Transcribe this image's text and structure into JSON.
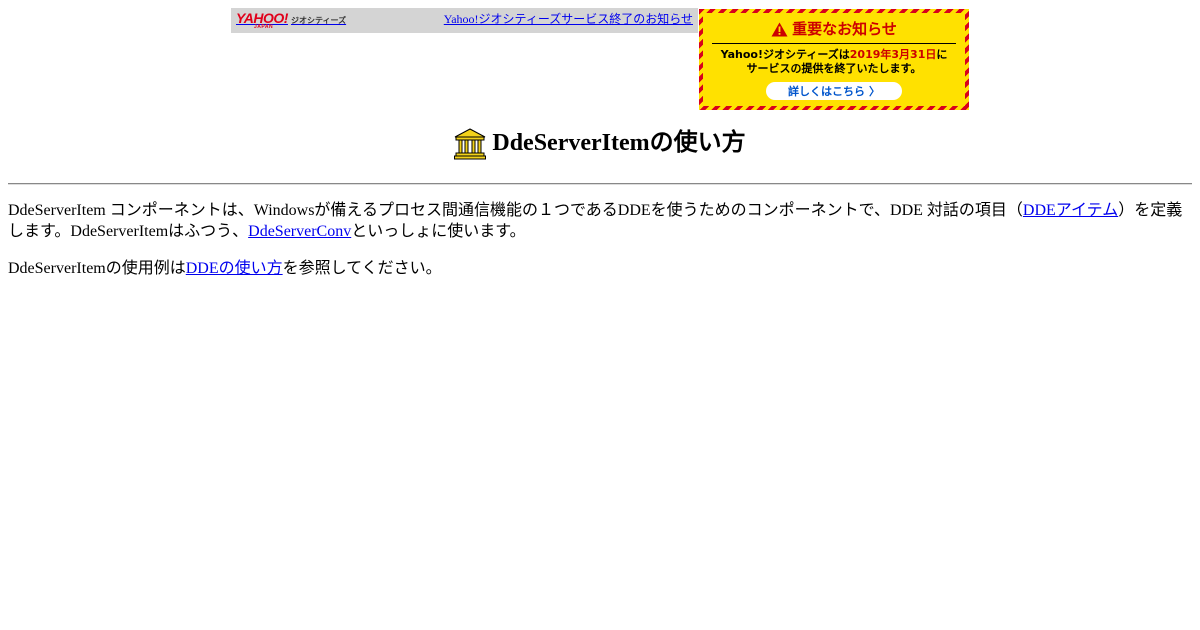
{
  "geo_bar": {
    "logo_text": "YAHOO!",
    "logo_sub": "JAPAN",
    "service_name": "ジオシティーズ",
    "notice_link": "Yahoo!ジオシティーズサービス終了のお知らせ"
  },
  "notice_banner": {
    "title": "重要なお知らせ",
    "line1_prefix": "Yahoo!ジオシティーズは",
    "line1_date": "2019年3月31日",
    "line1_suffix": "に",
    "line2": "サービスの提供を終了いたします。",
    "button_label": "詳しくはこちら",
    "button_chevron": "〉"
  },
  "heading": {
    "title": "DdeServerItemの使い方"
  },
  "body": {
    "p1_part1": "DdeServerItem コンポーネントは、Windowsが備えるプロセス間通信機能の１つであるDDEを使うためのコンポーネントで、DDE 対話の項目（",
    "p1_link1": "DDEアイテム",
    "p1_part2": "）を定義します。DdeServerItemはふつう、",
    "p1_link2": "DdeServerConv",
    "p1_part3": "といっしょに使います。",
    "p2_part1": "DdeServerItemの使用例は",
    "p2_link": "DDEの使い方",
    "p2_part2": "を参照してください。"
  },
  "colors": {
    "link": "#0000ee",
    "banner_yellow": "#ffe100",
    "banner_red": "#d8001c",
    "geo_bar_bg": "#d4d4d4"
  }
}
